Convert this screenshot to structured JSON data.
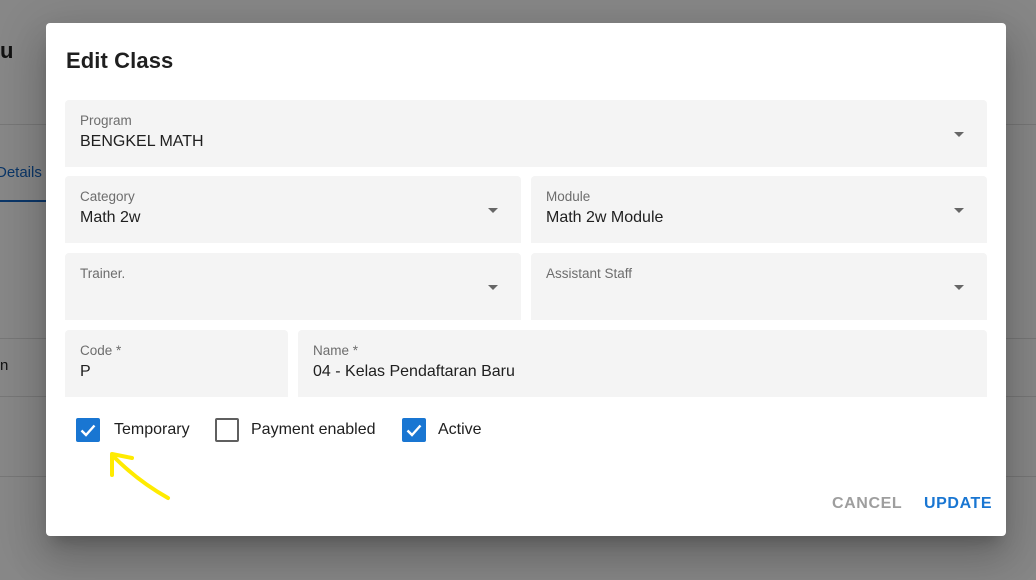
{
  "background": {
    "title_fragment": "u",
    "tab_fragment": "Details",
    "cell_fragment": "n"
  },
  "dialog": {
    "title": "Edit Class",
    "program": {
      "label": "Program",
      "value": "BENGKEL MATH"
    },
    "category": {
      "label": "Category",
      "value": "Math 2w"
    },
    "module": {
      "label": "Module",
      "value": "Math 2w Module"
    },
    "trainer": {
      "label": "Trainer.",
      "value": ""
    },
    "assistant_staff": {
      "label": "Assistant Staff",
      "value": ""
    },
    "code": {
      "label": "Code *",
      "value": "P"
    },
    "name": {
      "label": "Name *",
      "value": "04 - Kelas Pendaftaran Baru"
    },
    "checkboxes": {
      "temporary": {
        "label": "Temporary",
        "checked": true
      },
      "payment_enabled": {
        "label": "Payment enabled",
        "checked": false
      },
      "active": {
        "label": "Active",
        "checked": true
      }
    },
    "buttons": {
      "cancel": "CANCEL",
      "update": "UPDATE"
    }
  },
  "colors": {
    "accent": "#1976d2",
    "annotation_arrow": "#ffeb00"
  },
  "icons": {
    "dropdown": "caret-down-icon",
    "check": "checkmark-icon",
    "annotation": "arrow-annotation-icon"
  }
}
